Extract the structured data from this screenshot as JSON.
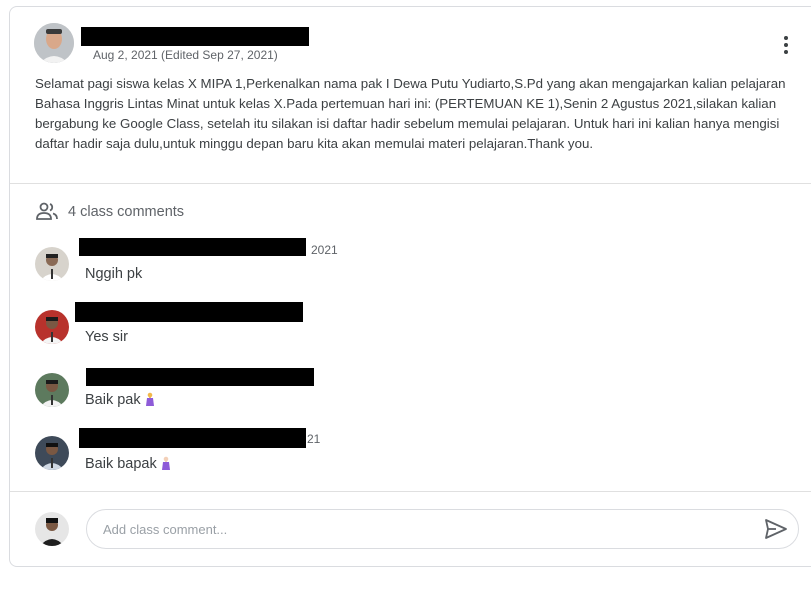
{
  "post": {
    "date": "Aug 2, 2021 (Edited Sep 27, 2021)",
    "body": "Selamat pagi siswa kelas X MIPA 1,Perkenalkan nama pak I Dewa Putu Yudiarto,S.Pd yang akan mengajarkan kalian pelajaran Bahasa Inggris Lintas Minat untuk kelas X.Pada pertemuan hari ini: (PERTEMUAN KE 1),Senin 2 Agustus 2021,silakan kalian bergabung ke Google Class, setelah itu silakan isi daftar hadir sebelum memulai pelajaran. Untuk hari ini kalian hanya mengisi daftar hadir saja dulu,untuk minggu depan baru kita akan memulai materi pelajaran.Thank you."
  },
  "comments_section": {
    "count_label": "4 class comments",
    "icon": "people-icon"
  },
  "comments": [
    {
      "stamp": "2021",
      "text": "Nggih pk"
    },
    {
      "stamp": "",
      "text": "Yes sir"
    },
    {
      "stamp": "",
      "text": "Baik pak"
    },
    {
      "stamp": "21",
      "text": "Baik bapak"
    }
  ],
  "composer": {
    "placeholder": "Add class comment...",
    "send_icon": "send-icon"
  },
  "colors": {
    "accent_gray": "#5f6368",
    "border": "#dadce0"
  }
}
